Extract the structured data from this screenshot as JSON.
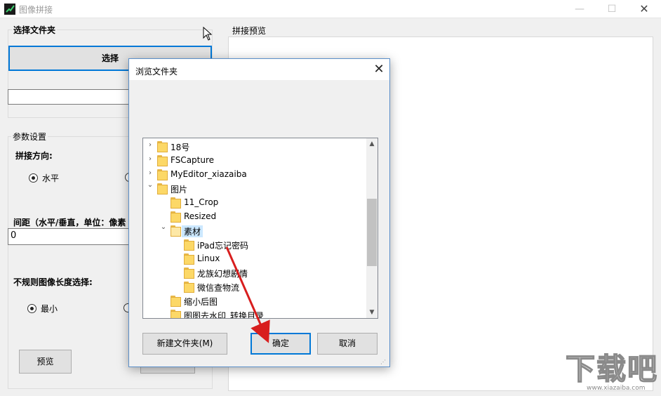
{
  "window": {
    "title": "图像拼接",
    "controls": {
      "minimize": "—",
      "maximize": "☐",
      "close": "✕"
    }
  },
  "left_panel": {
    "folder_group_label": "选择文件夹",
    "select_button": "选择",
    "path_value": "",
    "params_group_label": "参数设置",
    "direction_label": "拼接方向:",
    "direction_option_horizontal": "水平",
    "direction_selected": "水平",
    "spacing_label": "间距（水平/垂直，单位：像素",
    "spacing_value": "0",
    "irregular_label": "不规则图像长度选择:",
    "irregular_option_min": "最小",
    "irregular_selected": "最小",
    "preview_button": "预览"
  },
  "preview": {
    "label": "拼接预览"
  },
  "dialog": {
    "title": "浏览文件夹",
    "close": "✕",
    "tree": [
      {
        "label": "18号",
        "level": 0,
        "expander": "right"
      },
      {
        "label": "FSCapture",
        "level": 0,
        "expander": "right"
      },
      {
        "label": "MyEditor_xiazaiba",
        "level": 0,
        "expander": "right"
      },
      {
        "label": "图片",
        "level": 0,
        "expander": "down"
      },
      {
        "label": "11_Crop",
        "level": 1,
        "expander": "none"
      },
      {
        "label": "Resized",
        "level": 1,
        "expander": "none"
      },
      {
        "label": "素材",
        "level": 1,
        "expander": "down",
        "selected": true
      },
      {
        "label": "iPad忘记密码",
        "level": 2,
        "expander": "none"
      },
      {
        "label": "Linux",
        "level": 2,
        "expander": "none"
      },
      {
        "label": "龙族幻想剧情",
        "level": 2,
        "expander": "none"
      },
      {
        "label": "微信查物流",
        "level": 2,
        "expander": "none"
      },
      {
        "label": "缩小后图",
        "level": 1,
        "expander": "none"
      },
      {
        "label": "图图去水印_转换目录",
        "level": 1,
        "expander": "none"
      }
    ],
    "new_folder_button": "新建文件夹(M)",
    "ok_button": "确定",
    "cancel_button": "取消"
  },
  "watermark": {
    "text": "下载吧",
    "url": "www.xiazaiba.com"
  },
  "colors": {
    "accent": "#0078d7",
    "annotation_arrow": "#d81e1e",
    "folder": "#fcd867"
  }
}
